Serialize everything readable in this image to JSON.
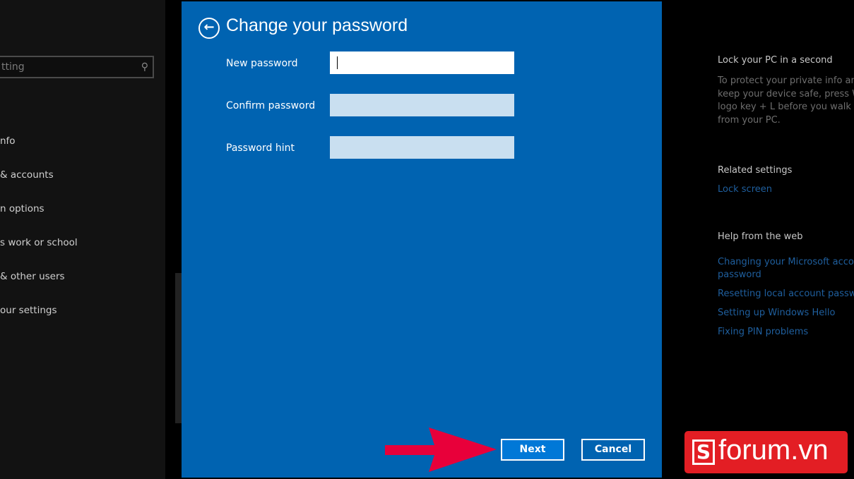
{
  "sidebar": {
    "search_placeholder": "tting",
    "search_icon": "search-icon",
    "items": [
      {
        "label": "nfo"
      },
      {
        "label": "& accounts"
      },
      {
        "label": "n options"
      },
      {
        "label": "s work or school"
      },
      {
        "label": "& other users"
      },
      {
        "label": "our settings"
      }
    ]
  },
  "dialog": {
    "title": "Change your password",
    "back_icon": "back-arrow-circle-icon",
    "fields": [
      {
        "label": "New password",
        "value": ""
      },
      {
        "label": "Confirm password",
        "value": ""
      },
      {
        "label": "Password hint",
        "value": ""
      }
    ],
    "next_label": "Next",
    "cancel_label": "Cancel"
  },
  "right": {
    "lock_title": "Lock your PC in a second",
    "lock_text": [
      "To protect your private info and",
      "keep your device safe, press Wi",
      "logo key + L before you walk av",
      "from your PC."
    ],
    "related_title": "Related settings",
    "related_links": [
      "Lock screen"
    ],
    "help_title": "Help from the web",
    "help_links": [
      "Changing your Microsoft accou",
      "password",
      "Resetting local account passwo",
      "Setting up Windows Hello",
      "Fixing PIN problems"
    ]
  },
  "watermark": {
    "text": "forum.vn",
    "letter": "S"
  },
  "colors": {
    "dialog": "#0063b1",
    "next": "#0078d7",
    "arrow": "#e8003a",
    "logo": "#e31e24",
    "link": "#1f5f9e"
  }
}
